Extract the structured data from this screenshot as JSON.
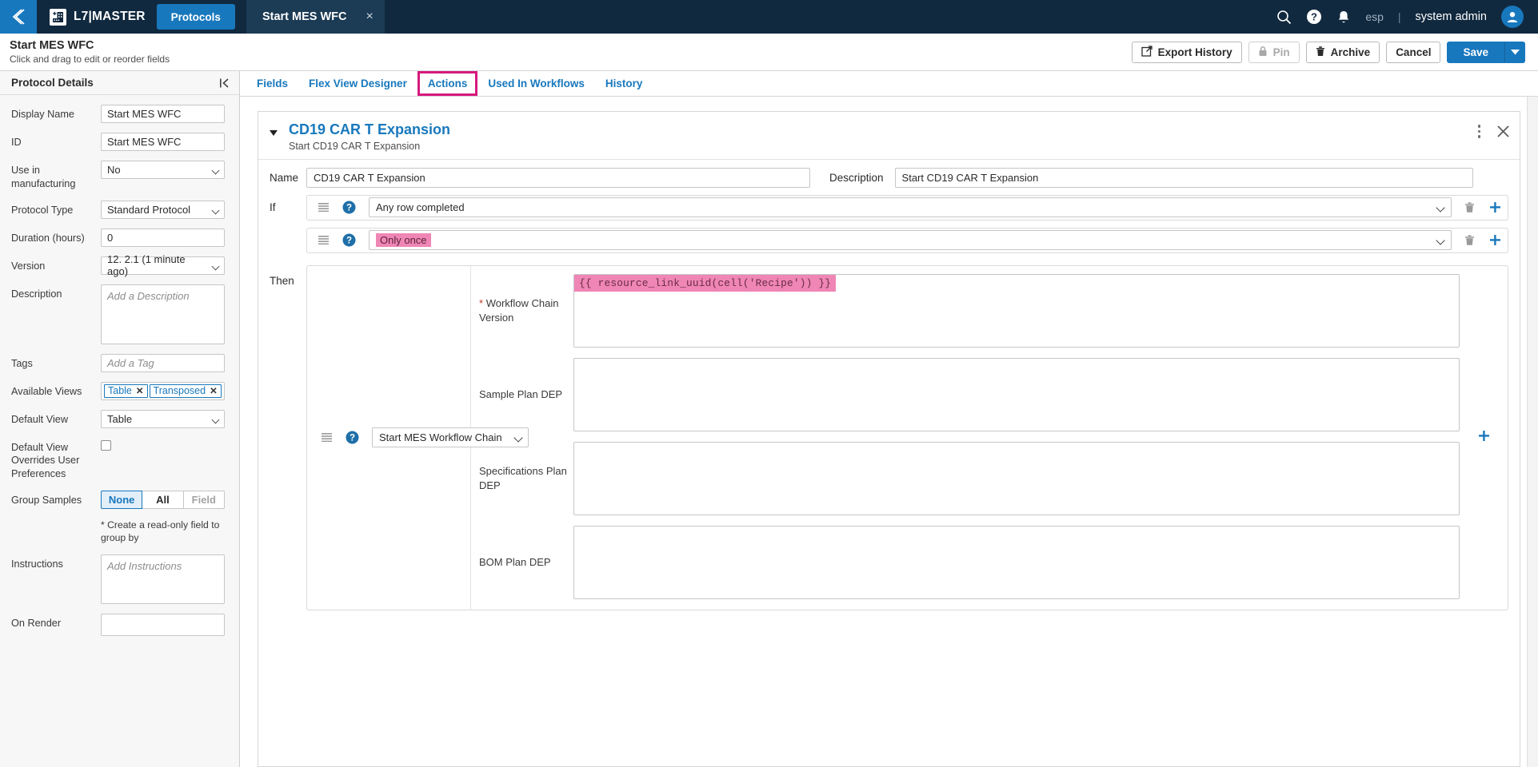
{
  "topnav": {
    "back_icon": "chevron-left-icon",
    "brand_icon": "building-plus-icon",
    "brand": "L7|MASTER",
    "protocols_label": "Protocols",
    "open_tab": "Start MES WFC",
    "tab_close": "×",
    "search_icon": "search-icon",
    "help_icon": "help-circle-icon",
    "bell_icon": "bell-icon",
    "language": "esp",
    "divider": "|",
    "user": "system admin",
    "avatar_icon": "user-avatar-icon"
  },
  "pageheader": {
    "title": "Start MES WFC",
    "subtitle": "Click and drag to edit or reorder fields",
    "buttons": {
      "export_history": "Export History",
      "pin": "Pin",
      "archive": "Archive",
      "cancel": "Cancel",
      "save": "Save",
      "save_caret_icon": "chevron-down-icon",
      "export_icon": "external-link-icon",
      "pin_icon": "lock-icon",
      "archive_icon": "trash-icon"
    }
  },
  "left_panel": {
    "title": "Protocol Details",
    "collapse_icon": "collapse-panel-icon",
    "fields": {
      "display_name": {
        "label": "Display Name",
        "value": "Start MES WFC"
      },
      "id": {
        "label": "ID",
        "value": "Start MES WFC"
      },
      "use_in_manufacturing": {
        "label": "Use in manufacturing",
        "value": "No"
      },
      "protocol_type": {
        "label": "Protocol Type",
        "value": "Standard Protocol"
      },
      "duration": {
        "label": "Duration (hours)",
        "value": "0"
      },
      "version": {
        "label": "Version",
        "value": "12. 2.1 (1 minute ago)"
      },
      "description": {
        "label": "Description",
        "placeholder": "Add a Description"
      },
      "tags": {
        "label": "Tags",
        "placeholder": "Add a Tag"
      },
      "available_views": {
        "label": "Available Views",
        "chips": [
          "Table",
          "Transposed"
        ],
        "chip_remove": "✕"
      },
      "default_view": {
        "label": "Default View",
        "value": "Table"
      },
      "default_view_overrides": {
        "label": "Default View Overrides User Preferences",
        "checked": false
      },
      "group_samples": {
        "label": "Group Samples",
        "options": [
          "None",
          "All",
          "Field"
        ],
        "selected": "None",
        "disabled": "Field"
      },
      "group_hint": "* Create a read-only field to group by",
      "instructions": {
        "label": "Instructions",
        "placeholder": "Add Instructions"
      },
      "on_render": {
        "label": "On Render",
        "value": ""
      }
    }
  },
  "tabs": [
    {
      "label": "Fields",
      "active": false
    },
    {
      "label": "Flex View Designer",
      "active": false
    },
    {
      "label": "Actions",
      "active": true
    },
    {
      "label": "Used In Workflows",
      "active": false
    },
    {
      "label": "History",
      "active": false
    }
  ],
  "card": {
    "caret_icon": "caret-down-icon",
    "title": "CD19 CAR T Expansion",
    "subtitle": "Start CD19 CAR T Expansion",
    "kebab_icon": "more-vertical-icon",
    "close_icon": "close-icon",
    "name_label": "Name",
    "name_value": "CD19 CAR T Expansion",
    "description_label": "Description",
    "description_value": "Start CD19 CAR T Expansion",
    "if_label": "If",
    "then_label": "Then",
    "conditions": [
      {
        "grip_icon": "drag-handle-icon",
        "help_icon": "help-circle-icon",
        "value": "Any row completed",
        "highlighted": false,
        "trash_icon": "trash-icon",
        "plus_icon": "plus-icon"
      },
      {
        "grip_icon": "drag-handle-icon",
        "help_icon": "help-circle-icon",
        "value": "Only once",
        "highlighted": true,
        "trash_icon": "trash-icon",
        "plus_icon": "plus-icon"
      }
    ],
    "then": {
      "grip_icon": "drag-handle-icon",
      "help_icon": "help-circle-icon",
      "action_value": "Start MES Workflow Chain",
      "plus_icon": "plus-icon",
      "fields": [
        {
          "label": "Workflow Chain Version",
          "required": true,
          "value": "{{ resource_link_uuid(cell('Recipe')) }}",
          "code": true
        },
        {
          "label": "Sample Plan DEP",
          "required": false,
          "value": "",
          "code": false
        },
        {
          "label": "Specifications Plan DEP",
          "required": false,
          "value": "",
          "code": false
        },
        {
          "label": "BOM Plan DEP",
          "required": false,
          "value": "",
          "code": false
        }
      ]
    }
  },
  "colors": {
    "navy": "#11293f",
    "blue": "#1878bd",
    "magenta": "#d6197d",
    "pink_highlight": "#ef86b5",
    "required_star": "#c0392b"
  }
}
